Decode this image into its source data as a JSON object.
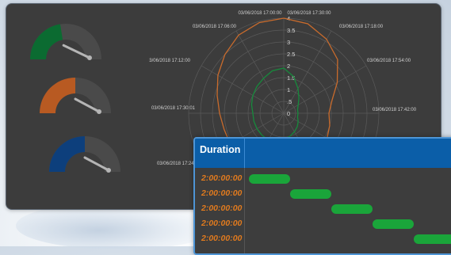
{
  "gauges": [
    {
      "name": "gauge-green",
      "color": "#0b6b31",
      "fraction": 0.45
    },
    {
      "name": "gauge-orange",
      "color": "#b85a22",
      "fraction": 0.5
    },
    {
      "name": "gauge-blue",
      "color": "#0d3f7c",
      "fraction": 0.5
    }
  ],
  "radar": {
    "ticks": [
      "4",
      "3.5",
      "3",
      "2.5",
      "2",
      "1.5",
      "1",
      ".5",
      "0"
    ],
    "axis_labels": [
      "03/06/2018 17:00:00",
      "03/06/2018 17:30:00",
      "03/06/2018 17:06:00",
      "03/06/2018 17:18:00",
      "03/06/2018 17:54:00",
      "03/06/2018 17:30:01",
      "03/06/2018 17:42:00"
    ],
    "series_colors": {
      "orange": "#c96b2c",
      "green": "#178a3c"
    }
  },
  "duration": {
    "title": "Duration",
    "rows": [
      {
        "label": "2:00:00:00",
        "start": 0
      },
      {
        "label": "2:00:00:00",
        "start": 1
      },
      {
        "label": "2:00:00:00",
        "start": 2
      },
      {
        "label": "2:00:00:00",
        "start": 3
      },
      {
        "label": "2:00:00:00",
        "start": 4
      }
    ]
  }
}
